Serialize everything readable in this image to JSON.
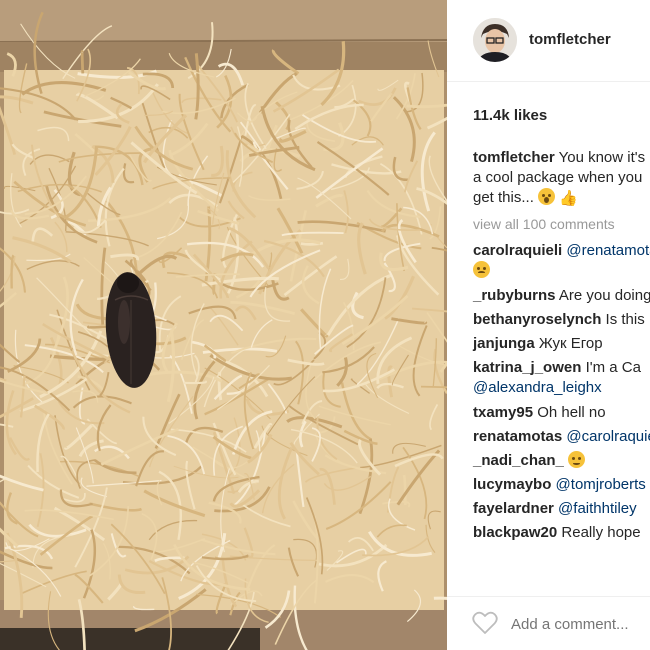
{
  "post": {
    "username": "tomfletcher",
    "likes": "11.4k likes",
    "caption": {
      "username": "tomfletcher",
      "text": "You know it's a cool package when you get this..."
    },
    "view_all": "view all 100 comments",
    "comments": [
      {
        "user": "carolraquieli",
        "text": "@renatamotas",
        "emoji": "yellow-face"
      },
      {
        "user": "_rubyburns",
        "text": "Are you doing"
      },
      {
        "user": "bethanyroselynch",
        "text": "Is this"
      },
      {
        "user": "janjunga",
        "text": "Жук Егор"
      },
      {
        "user": "katrina_j_owen",
        "text": "I'm a Ca",
        "mention": "@alexandra_leighx"
      },
      {
        "user": "txamy95",
        "text": "Oh hell no"
      },
      {
        "user": "renatamotas",
        "text": "@carolraquieli"
      },
      {
        "user": "_nadi_chan_",
        "emoji": "worried-face"
      },
      {
        "user": "lucymaybo",
        "text": "@tomjroberts"
      },
      {
        "user": "fayelardner",
        "text": "@faithhtiley"
      },
      {
        "user": "blackpaw20",
        "text": "Really hope"
      }
    ],
    "add_comment_placeholder": "Add a comment..."
  },
  "icons": {
    "like": "heart-outline-icon",
    "caption_emoji_1": "screaming-face-icon",
    "caption_emoji_2": "thumbs-up-icon"
  },
  "colors": {
    "username": "#262626",
    "mention": "#003569",
    "muted": "#999999",
    "straw": "#e9d2a8",
    "cardboard": "#a88a67",
    "cockroach": "#2b2423"
  }
}
